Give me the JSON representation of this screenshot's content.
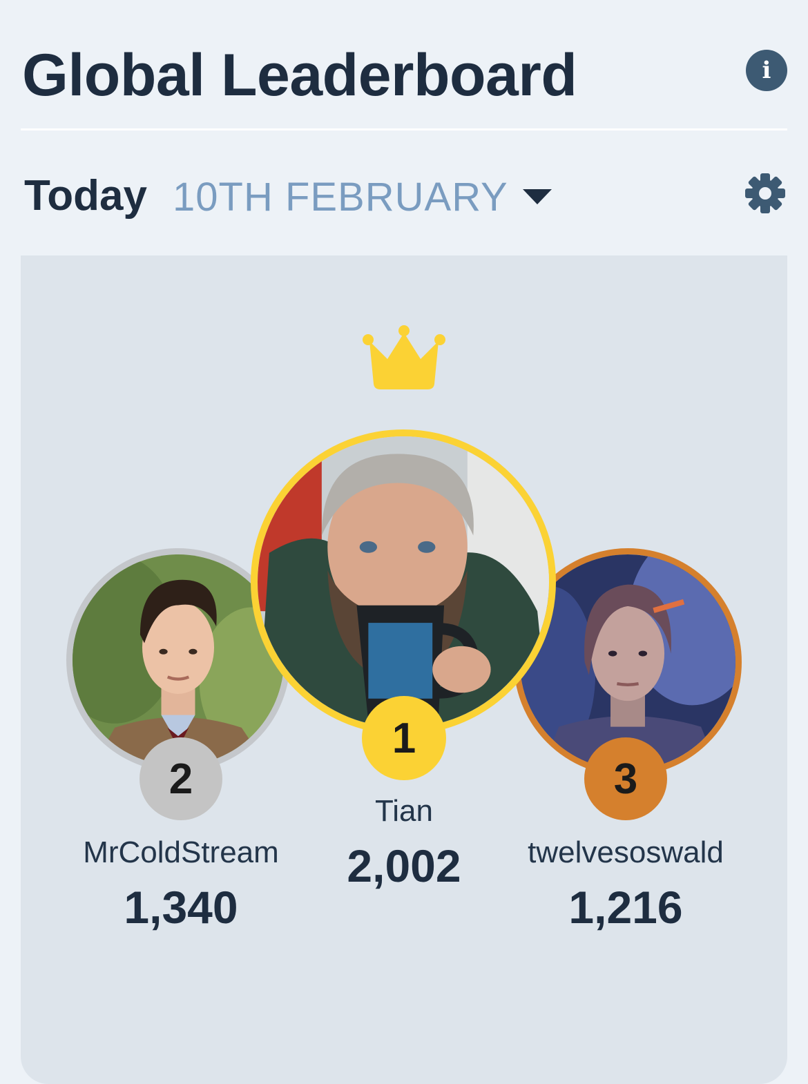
{
  "header": {
    "title": "Global Leaderboard",
    "info_icon": "info-icon"
  },
  "date_selector": {
    "period": "Today",
    "date": "10TH FEBRUARY",
    "dropdown_icon": "caret-down-icon",
    "settings_icon": "gear-icon"
  },
  "podium": {
    "crown_icon": "crown-icon",
    "colors": {
      "gold": "#fbd234",
      "silver": "#c4c4c4",
      "bronze": "#d5802d"
    },
    "entries": [
      {
        "rank": "1",
        "name": "Tian",
        "score": "2,002"
      },
      {
        "rank": "2",
        "name": "MrColdStream",
        "score": "1,340"
      },
      {
        "rank": "3",
        "name": "twelvesoswald",
        "score": "1,216"
      }
    ]
  }
}
